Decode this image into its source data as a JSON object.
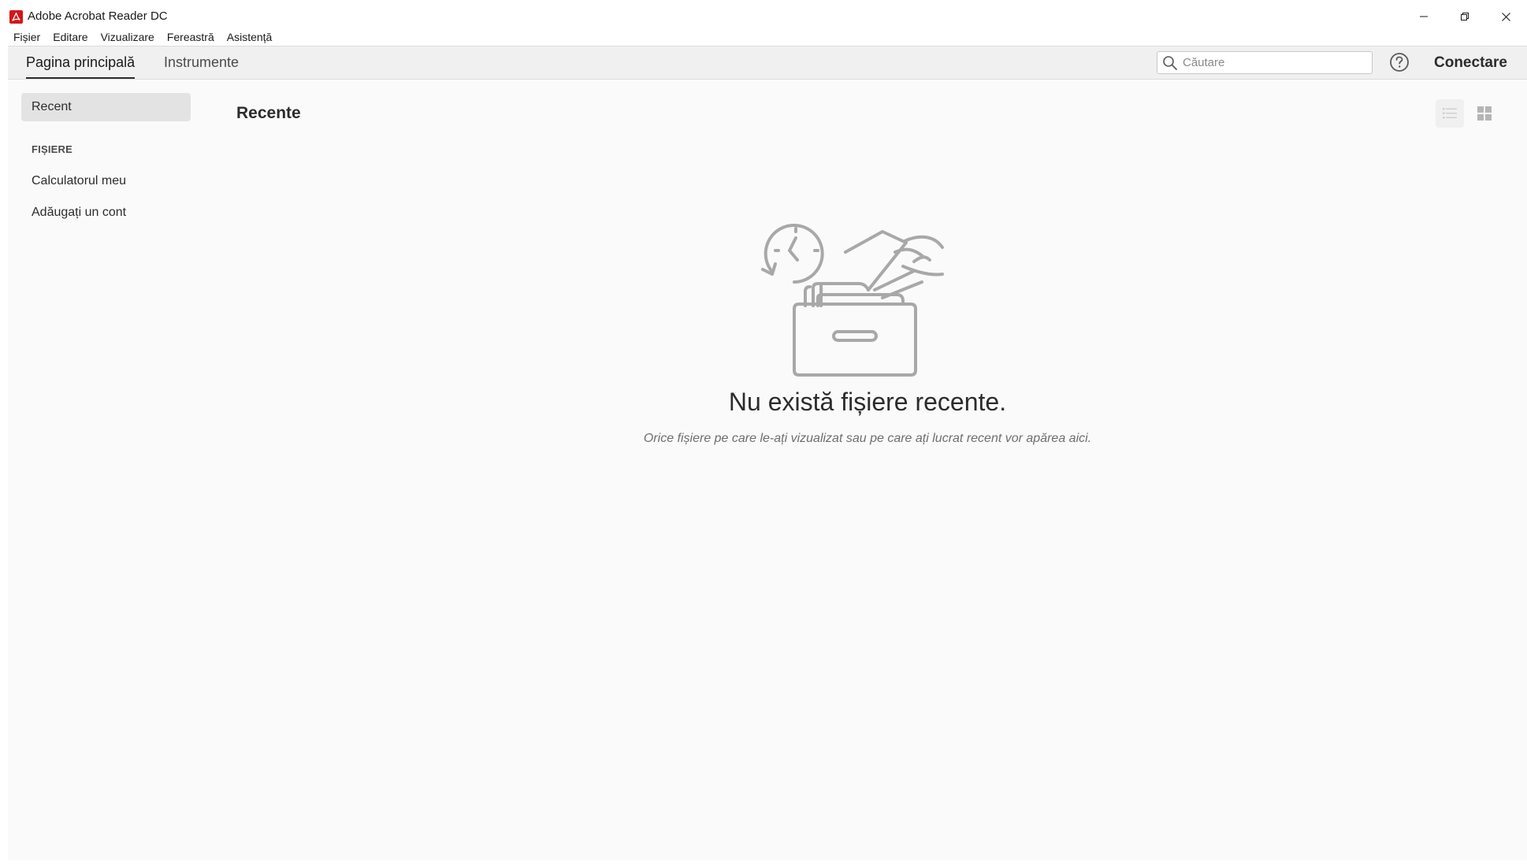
{
  "window": {
    "title": "Adobe Acrobat Reader DC",
    "controls": [
      "minimize",
      "restore",
      "close"
    ]
  },
  "menu": {
    "items": [
      "Fișier",
      "Editare",
      "Vizualizare",
      "Fereastră",
      "Asistență"
    ]
  },
  "nav": {
    "tabs": [
      {
        "label": "Pagina principală",
        "active": true
      },
      {
        "label": "Instrumente",
        "active": false
      }
    ],
    "search_placeholder": "Căutare",
    "connect_label": "Conectare"
  },
  "sidebar": {
    "recent_label": "Recent",
    "section_label": "FIȘIERE",
    "items": [
      "Calculatorul meu",
      "Adăugați un cont"
    ]
  },
  "main": {
    "heading": "Recente",
    "empty_title": "Nu există fișiere recente.",
    "empty_subtitle": "Orice fișiere pe care le-ați vizualizat sau pe care ați lucrat recent vor apărea aici."
  },
  "colors": {
    "brand": "#d7141a",
    "background": "#fafafa",
    "illustration": "#a8a8a8"
  },
  "icons": [
    "acrobat-logo-icon",
    "minimize-icon",
    "restore-icon",
    "close-icon",
    "search-icon",
    "help-icon",
    "list-view-icon",
    "grid-view-icon",
    "empty-files-illustration"
  ]
}
